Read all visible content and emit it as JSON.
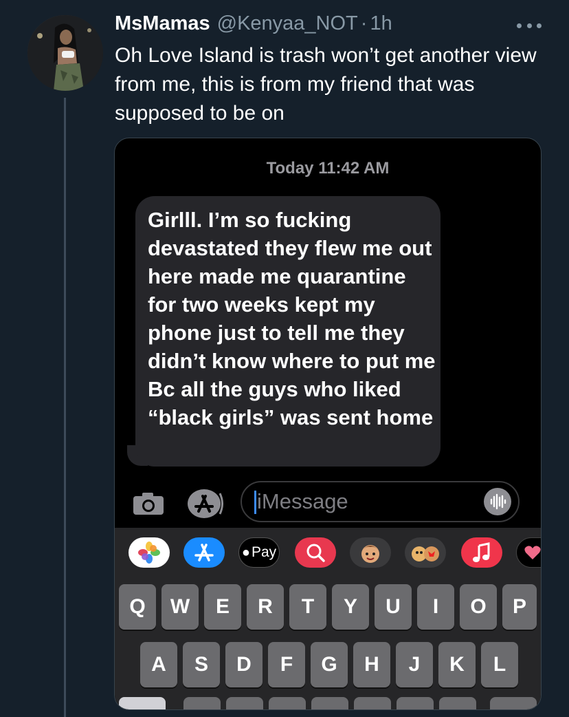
{
  "tweet": {
    "display_name": "MsMamas",
    "handle": "@Kenyaa_NOT",
    "separator": "·",
    "time": "1h",
    "text": "Oh Love Island is trash won’t get another view from me, this is from my friend that was supposed to be on"
  },
  "screenshot": {
    "timestamp": "Today 11:42 AM",
    "message": "Girlll. I’m so fucking devastated they flew me out here made me quarantine for two weeks kept my phone just to tell me they didn’t know where to put me Bc all the guys who liked “black girls” was sent home",
    "input_placeholder": "iMessage",
    "apple_pay_label": "Pay",
    "app_tray": [
      {
        "name": "photos-icon",
        "bg": "#ffffff"
      },
      {
        "name": "app-store-icon",
        "bg": "#1a8cff"
      },
      {
        "name": "apple-pay-icon",
        "bg": "#000000"
      },
      {
        "name": "search-images-icon",
        "bg": "#e8384f"
      },
      {
        "name": "memoji-icon",
        "bg": "#3a3a3c"
      },
      {
        "name": "memoji-stickers-icon",
        "bg": "#3a3a3c"
      },
      {
        "name": "music-icon",
        "bg": "#f0354b"
      },
      {
        "name": "heart-icon",
        "bg": "#000000"
      }
    ],
    "keyboard": {
      "row1": [
        "Q",
        "W",
        "E",
        "R",
        "T",
        "Y",
        "U",
        "I",
        "O",
        "P"
      ],
      "row2": [
        "A",
        "S",
        "D",
        "F",
        "G",
        "H",
        "J",
        "K",
        "L"
      ]
    }
  }
}
